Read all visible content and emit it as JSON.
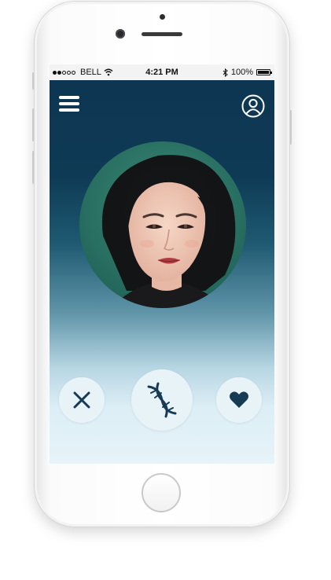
{
  "status_bar": {
    "carrier": "BELL",
    "signal_bars_filled": 2,
    "signal_bars_total": 5,
    "time": "4:21 PM",
    "battery": "100%",
    "battery_level": 1.0,
    "icons": [
      "wifi-icon",
      "bluetooth-icon",
      "battery-icon"
    ]
  },
  "header": {
    "menu_icon": "hamburger-menu-icon",
    "profile_icon": "user-circle-icon"
  },
  "profile": {
    "photo": "profile-photo-woman"
  },
  "actions": [
    {
      "name": "reject",
      "icon": "close-x-icon"
    },
    {
      "name": "dna-match",
      "icon": "dna-helix-icon"
    },
    {
      "name": "like",
      "icon": "heart-icon"
    }
  ],
  "colors": {
    "screen_top": "#0d3551",
    "screen_bottom": "#e6f3f9",
    "icon_dark": "#173a55",
    "button_bg": "#e8f3f8"
  }
}
